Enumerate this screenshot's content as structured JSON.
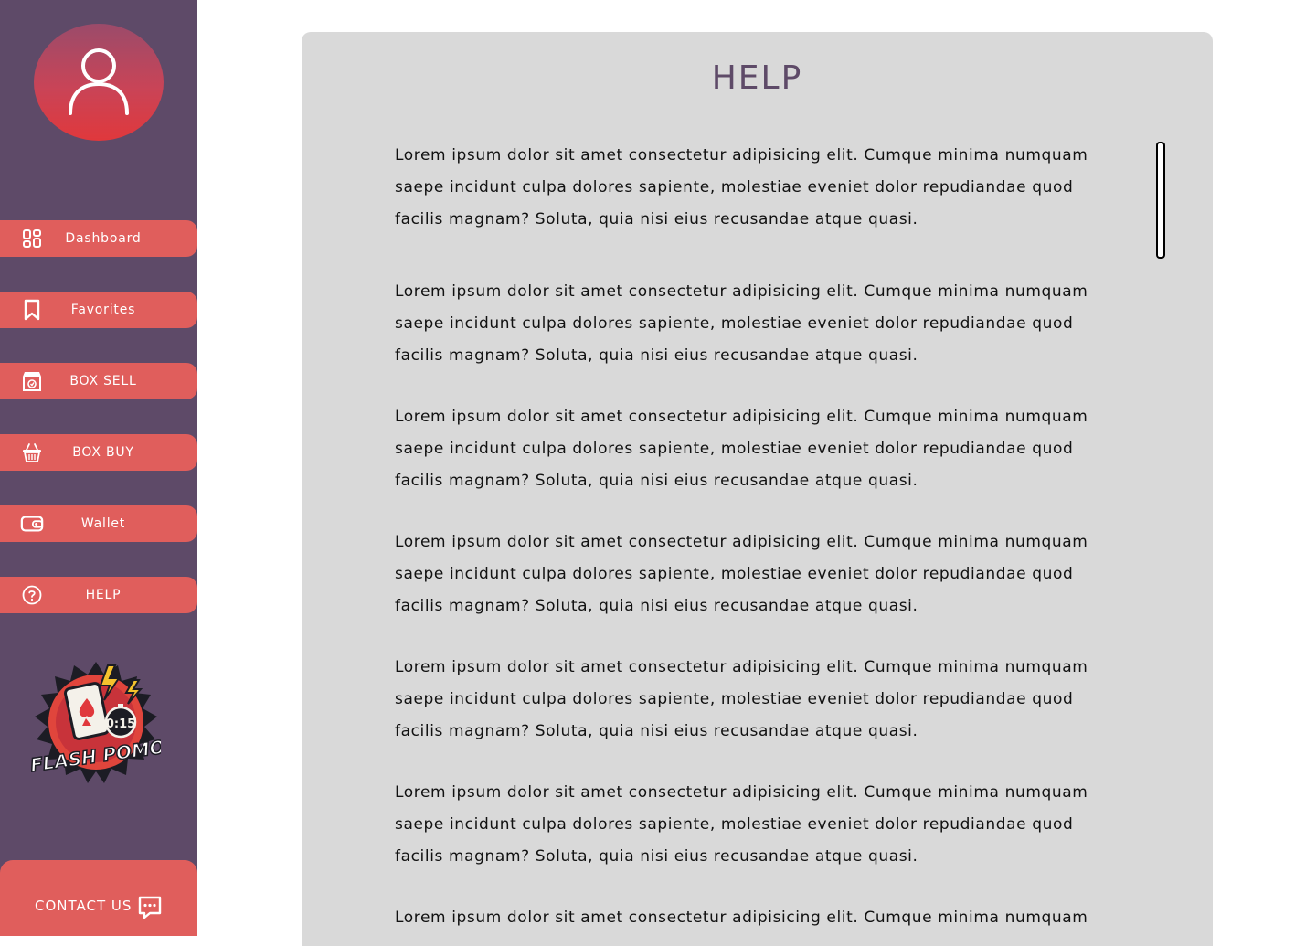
{
  "sidebar": {
    "nav": [
      {
        "label": "Dashboard",
        "icon": "dashboard-grid-icon"
      },
      {
        "label": "Favorites",
        "icon": "bookmark-icon"
      },
      {
        "label": "BOX SELL",
        "icon": "shop-icon"
      },
      {
        "label": "BOX BUY",
        "icon": "basket-icon"
      },
      {
        "label": "Wallet",
        "icon": "wallet-icon"
      },
      {
        "label": "HELP",
        "icon": "help-circle-icon"
      }
    ],
    "logo": {
      "text_top": "FLASH POMO",
      "timer": "0:15"
    },
    "contact": {
      "label": "CONTACT US",
      "icon": "chat-bubble-icon"
    }
  },
  "help": {
    "title": "HELP",
    "paragraphs": [
      "Lorem ipsum dolor sit amet consectetur adipisicing elit. Cumque minima numquam saepe incidunt culpa dolores sapiente, molestiae eveniet dolor repudiandae quod facilis magnam? Soluta, quia nisi eius recusandae atque quasi.",
      "Lorem ipsum dolor sit amet consectetur adipisicing elit. Cumque minima numquam saepe incidunt culpa dolores sapiente, molestiae eveniet dolor repudiandae quod facilis magnam? Soluta, quia nisi eius recusandae atque quasi.",
      "Lorem ipsum dolor sit amet consectetur adipisicing elit. Cumque minima numquam saepe incidunt culpa dolores sapiente, molestiae eveniet dolor repudiandae quod facilis magnam? Soluta, quia nisi eius recusandae atque quasi.",
      "Lorem ipsum dolor sit amet consectetur adipisicing elit. Cumque minima numquam saepe incidunt culpa dolores sapiente, molestiae eveniet dolor repudiandae quod facilis magnam? Soluta, quia nisi eius recusandae atque quasi.",
      "Lorem ipsum dolor sit amet consectetur adipisicing elit. Cumque minima numquam saepe incidunt culpa dolores sapiente, molestiae eveniet dolor repudiandae quod facilis magnam? Soluta, quia nisi eius recusandae atque quasi.",
      "Lorem ipsum dolor sit amet consectetur adipisicing elit. Cumque minima numquam saepe incidunt culpa dolores sapiente, molestiae eveniet dolor repudiandae quod facilis magnam? Soluta, quia nisi eius recusandae atque quasi.",
      "Lorem ipsum dolor sit amet consectetur adipisicing elit. Cumque minima numquam"
    ]
  },
  "colors": {
    "sidebar_bg": "#5e4a68",
    "nav_button": "#e05e5c",
    "panel_bg": "#d9d9d9",
    "title": "#5e4a68",
    "avatar_gradient_top": "#9b4b6a",
    "avatar_gradient_bottom": "#e0383c"
  }
}
